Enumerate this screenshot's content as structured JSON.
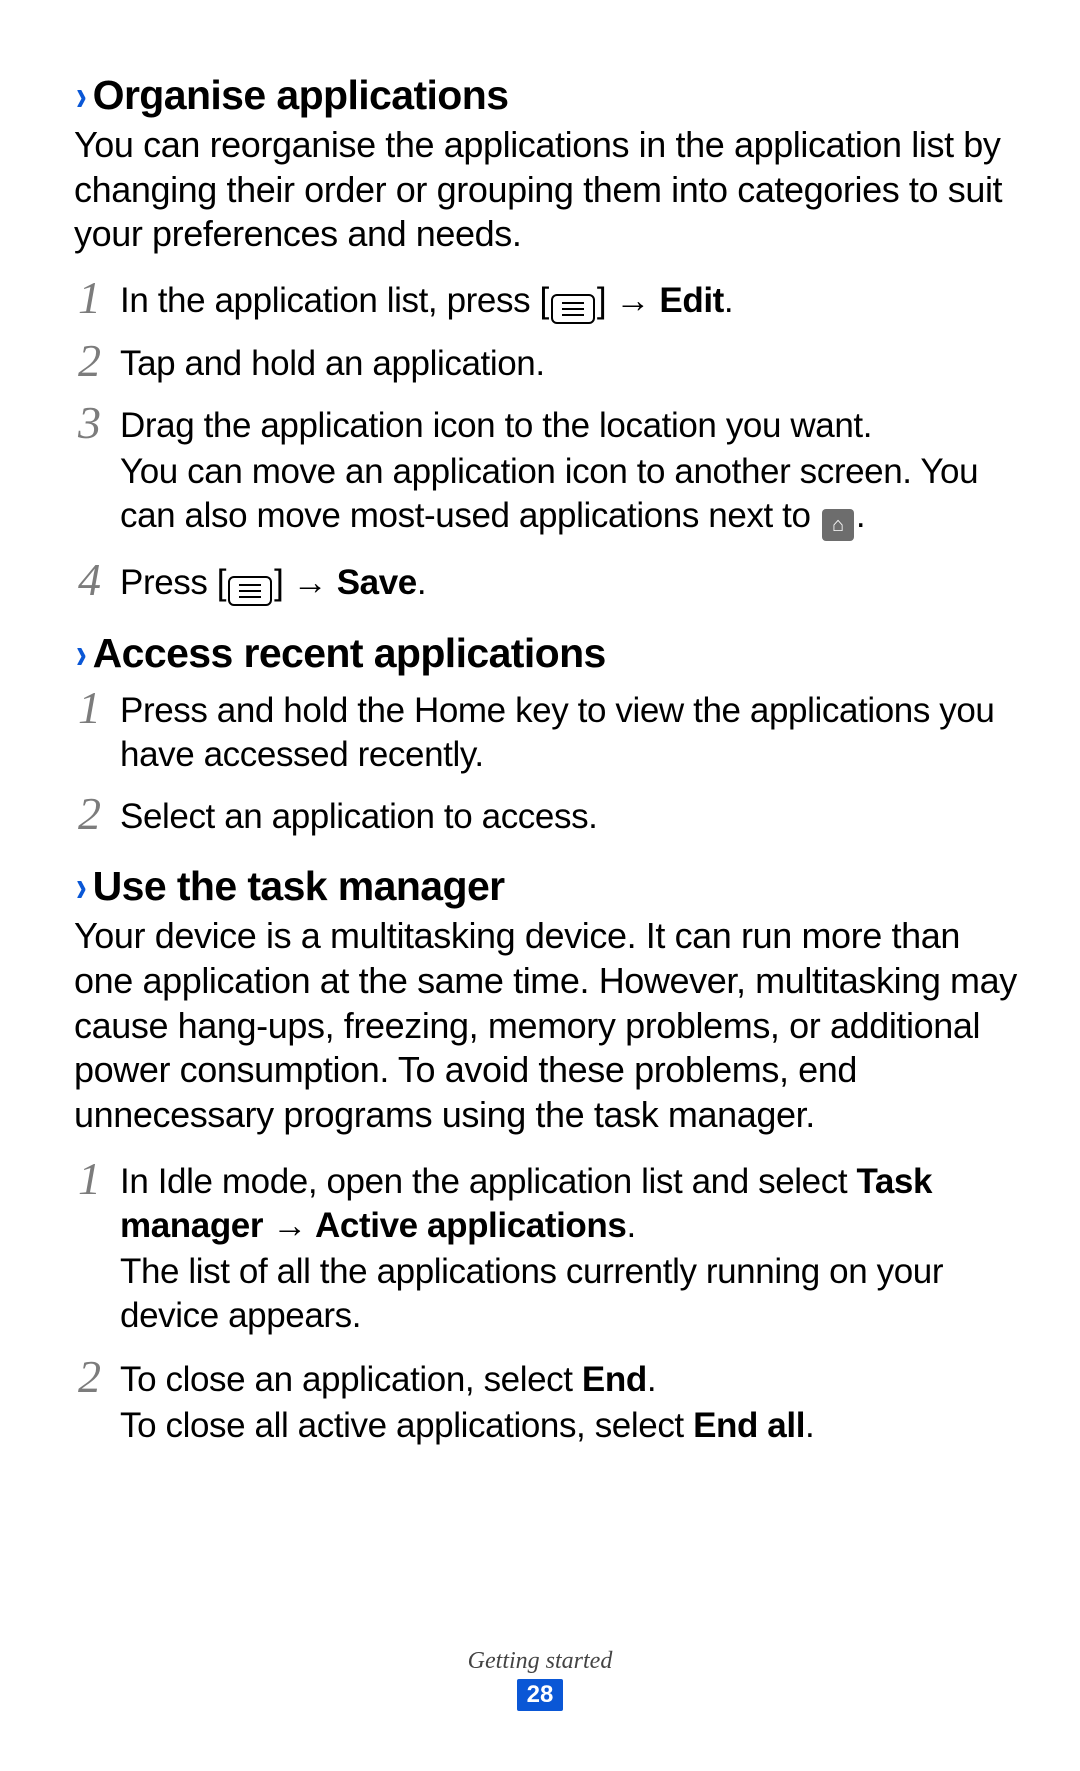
{
  "sections": {
    "organise": {
      "heading": "Organise applications",
      "intro": "You can reorganise the applications in the application list by changing their order or grouping them into categories to suit your preferences and needs.",
      "step1_prefix": "In the application list, press [",
      "step1_suffix": "] → ",
      "step1_bold": "Edit",
      "step1_end": ".",
      "step2": "Tap and hold an application.",
      "step3_line1": "Drag the application icon to the location you want.",
      "step3_line2_prefix": "You can move an application icon to another screen. You can also move most-used applications next to ",
      "step3_line2_suffix": ".",
      "step4_prefix": "Press [",
      "step4_suffix": "] → ",
      "step4_bold": "Save",
      "step4_end": "."
    },
    "recent": {
      "heading": "Access recent applications",
      "step1": "Press and hold the Home key to view the applications you have accessed recently.",
      "step2": "Select an application to access."
    },
    "taskmgr": {
      "heading": "Use the task manager",
      "intro": "Your device is a multitasking device. It can run more than one application at the same time. However, multitasking may cause hang-ups, freezing, memory problems, or additional power consumption. To avoid these problems, end unnecessary programs using the task manager.",
      "step1_prefix": "In Idle mode, open the application list and select ",
      "step1_bold": "Task manager → Active applications",
      "step1_end": ".",
      "step1_line2": "The list of all the applications currently running on your device appears.",
      "step2_prefix": "To close an application, select ",
      "step2_bold": "End",
      "step2_end": ".",
      "step2_line2_prefix": "To close all active applications, select ",
      "step2_line2_bold": "End all",
      "step2_line2_end": "."
    }
  },
  "nums": {
    "n1": "1",
    "n2": "2",
    "n3": "3",
    "n4": "4"
  },
  "footer": {
    "section": "Getting started",
    "page": "28"
  }
}
